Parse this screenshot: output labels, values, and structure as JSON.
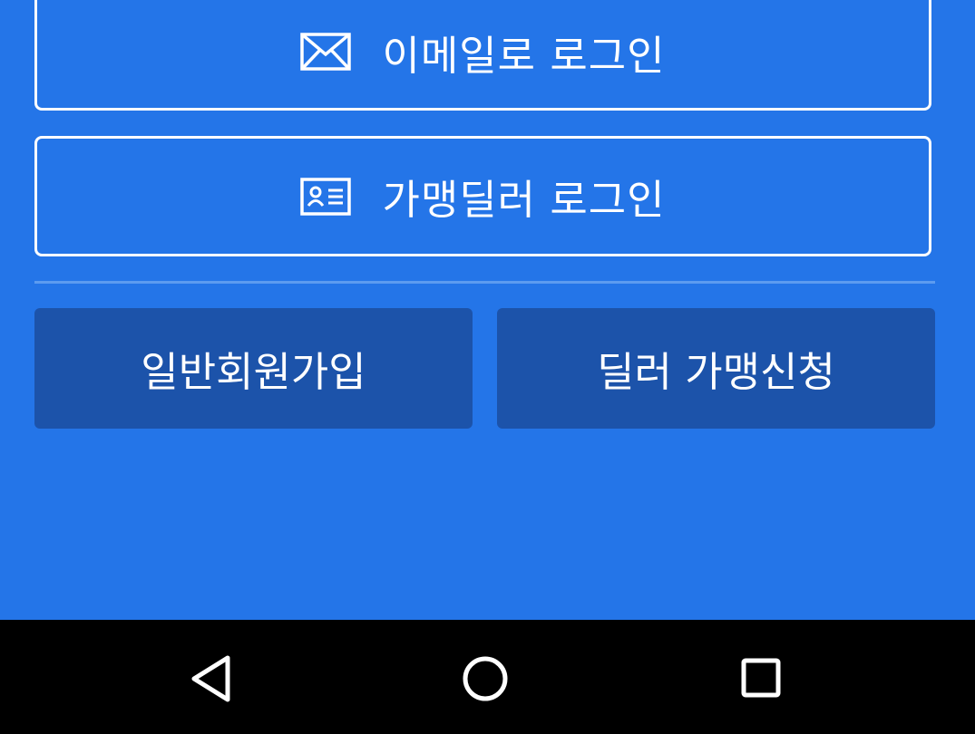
{
  "login": {
    "email_label": "이메일로 로그인",
    "email_icon": "envelope-icon",
    "dealer_label": "가맹딜러 로그인",
    "dealer_icon": "id-card-icon"
  },
  "actions": {
    "signup_label": "일반회원가입",
    "dealer_apply_label": "딜러 가맹신청"
  },
  "nav_bar": {
    "back_icon": "back-triangle-icon",
    "home_icon": "home-circle-icon",
    "recent_icon": "recent-apps-square-icon"
  },
  "colors": {
    "background": "#2475E8",
    "secondary_button": "#1C53AA",
    "nav_bar": "#000000",
    "text": "#FFFFFF"
  }
}
